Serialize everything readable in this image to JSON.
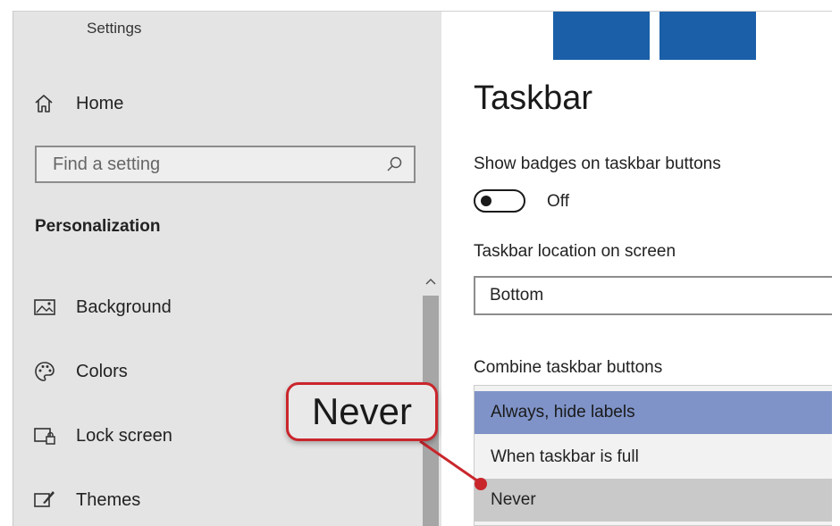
{
  "window": {
    "title": "Settings"
  },
  "sidebar": {
    "home": {
      "label": "Home",
      "icon": "home-icon"
    },
    "search": {
      "placeholder": "Find a setting",
      "icon": "search-icon"
    },
    "section_title": "Personalization",
    "items": [
      {
        "label": "Background",
        "icon": "image-icon"
      },
      {
        "label": "Colors",
        "icon": "palette-icon"
      },
      {
        "label": "Lock screen",
        "icon": "lock-screen-icon"
      },
      {
        "label": "Themes",
        "icon": "brush-icon"
      }
    ]
  },
  "main": {
    "title": "Taskbar",
    "badges": {
      "label": "Show badges on taskbar buttons",
      "state_text": "Off",
      "enabled": false
    },
    "location": {
      "label": "Taskbar location on screen",
      "value": "Bottom"
    },
    "combine": {
      "label": "Combine taskbar buttons",
      "options": [
        "Always, hide labels",
        "When taskbar is full",
        "Never"
      ],
      "selected": "Always, hide labels",
      "highlighted": "Never"
    }
  },
  "annotation": {
    "text": "Never",
    "color": "#c9262c"
  },
  "colors": {
    "sidebar_bg": "#e4e4e4",
    "accent_selected": "#7f93c8",
    "logo_blue": "#1a5fa8"
  }
}
